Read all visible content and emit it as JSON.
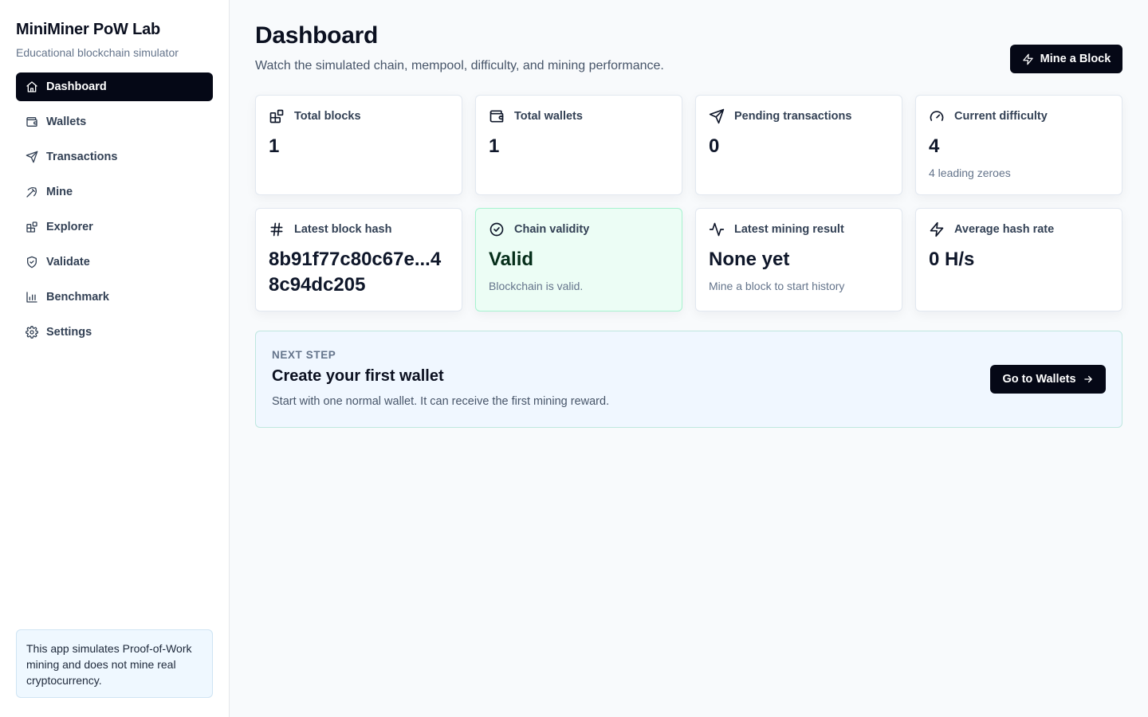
{
  "sidebar": {
    "title": "MiniMiner PoW Lab",
    "subtitle": "Educational blockchain simulator",
    "items": [
      {
        "label": "Dashboard",
        "icon": "home-icon",
        "active": true
      },
      {
        "label": "Wallets",
        "icon": "wallet-icon"
      },
      {
        "label": "Transactions",
        "icon": "send-icon"
      },
      {
        "label": "Mine",
        "icon": "pickaxe-icon"
      },
      {
        "label": "Explorer",
        "icon": "blocks-icon"
      },
      {
        "label": "Validate",
        "icon": "shield-check-icon"
      },
      {
        "label": "Benchmark",
        "icon": "bar-chart-icon"
      },
      {
        "label": "Settings",
        "icon": "gear-icon"
      }
    ],
    "notice": "This app simulates Proof-of-Work mining and does not mine real cryptocurrency."
  },
  "header": {
    "title": "Dashboard",
    "subtitle": "Watch the simulated chain, mempool, difficulty, and mining performance.",
    "action_label": "Mine a Block"
  },
  "stats": [
    {
      "label": "Total blocks",
      "value": "1",
      "icon": "blocks-icon"
    },
    {
      "label": "Total wallets",
      "value": "1",
      "icon": "wallet-icon"
    },
    {
      "label": "Pending transactions",
      "value": "0",
      "icon": "send-icon"
    },
    {
      "label": "Current difficulty",
      "value": "4",
      "note": "4 leading zeroes",
      "icon": "gauge-icon"
    },
    {
      "label": "Latest block hash",
      "value": "8b91f77c80c67e...48c94dc205",
      "icon": "hash-icon"
    },
    {
      "label": "Chain validity",
      "value": "Valid",
      "note": "Blockchain is valid.",
      "icon": "check-circle-icon"
    },
    {
      "label": "Latest mining result",
      "value": "None yet",
      "note": "Mine a block to start history",
      "icon": "activity-icon"
    },
    {
      "label": "Average hash rate",
      "value": "0 H/s",
      "icon": "zap-icon"
    }
  ],
  "next_step": {
    "eyebrow": "NEXT STEP",
    "title": "Create your first wallet",
    "description": "Start with one normal wallet. It can receive the first mining reward.",
    "button_label": "Go to Wallets"
  },
  "colors": {
    "primary": "#050816",
    "valid_bg": "#ecfdf5",
    "info_bg": "#f0f7ff"
  }
}
